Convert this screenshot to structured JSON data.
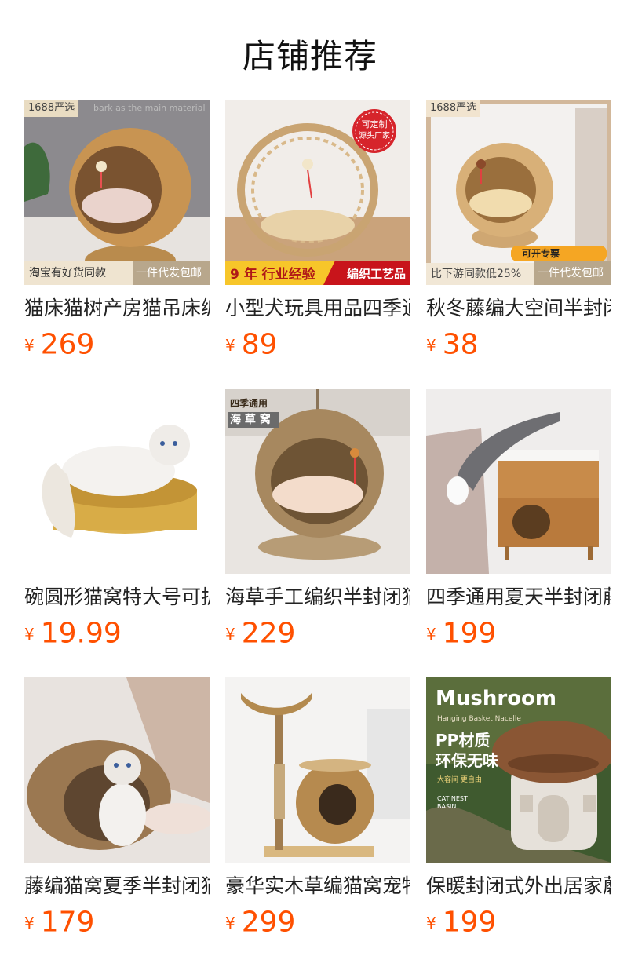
{
  "page_title": "店铺推荐",
  "currency": "¥",
  "products": [
    {
      "title": "猫床猫树产房猫吊床编织猫窝",
      "price": "269",
      "tags": {
        "top_left": "1688严选",
        "top_right": "bark as the main material",
        "bottom_left": "淘宝有好货同款",
        "bottom_right": "一件代发包邮"
      }
    },
    {
      "title": "小型犬玩具用品四季通用猫窝",
      "price": "89",
      "tags": {
        "badge_line1": "可定制",
        "badge_line2": "源头厂家",
        "bottom_left": "9 年 行业经验",
        "bottom_right": "编织工艺品"
      }
    },
    {
      "title": "秋冬藤编大空间半封闭猫窝",
      "price": "38",
      "tags": {
        "top_left": "1688严选",
        "mid_right": "可开专票",
        "bottom_left": "比下游同款低25%",
        "bottom_right": "一件代发包邮"
      }
    },
    {
      "title": "碗圆形猫窝特大号可拆洗",
      "price": "19.99",
      "tags": {}
    },
    {
      "title": "海草手工编织半封闭猫窝",
      "price": "229",
      "tags": {
        "top_left_line1": "四季通用",
        "top_left_line2": "海 草 窝"
      }
    },
    {
      "title": "四季通用夏天半封闭藤编猫柜",
      "price": "199",
      "tags": {}
    },
    {
      "title": "藤编猫窝夏季半封闭猫屋",
      "price": "179",
      "tags": {}
    },
    {
      "title": "豪华实木草编猫窝宠物猫爬架",
      "price": "299",
      "tags": {}
    },
    {
      "title": "保暖封闭式外出居家蘑菇猫窝",
      "price": "199",
      "tags": {
        "headline": "Mushroom",
        "sub": "Hanging Basket Nacelle",
        "line1": "PP材质",
        "line2": "环保无味",
        "small": "大容间 更自由",
        "small2": "CAT NEST BASIN"
      }
    }
  ]
}
